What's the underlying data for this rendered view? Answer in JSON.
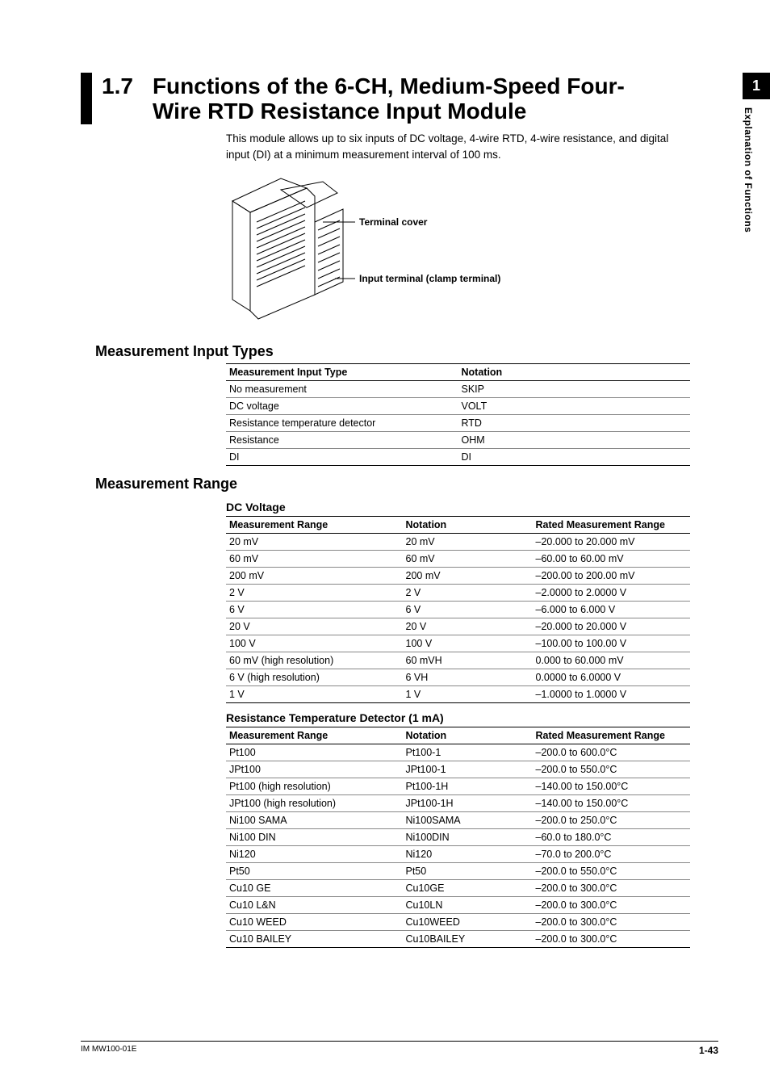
{
  "sidebar": {
    "chapter_num": "1",
    "chapter_label": "Explanation of Functions"
  },
  "header": {
    "number": "1.7",
    "title": "Functions of the 6-CH, Medium-Speed Four-Wire RTD Resistance Input Module"
  },
  "intro": "This module allows up to six inputs of DC voltage, 4-wire RTD, 4-wire resistance, and digital input (DI) at a minimum measurement interval of 100 ms.",
  "diagram": {
    "callout1": "Terminal cover",
    "callout2": "Input terminal (clamp terminal)"
  },
  "sec_input_types": {
    "heading": "Measurement Input Types",
    "cols": [
      "Measurement Input Type",
      "Notation"
    ],
    "rows": [
      [
        "No measurement",
        "SKIP"
      ],
      [
        "DC voltage",
        "VOLT"
      ],
      [
        "Resistance temperature detector",
        "RTD"
      ],
      [
        "Resistance",
        "OHM"
      ],
      [
        "DI",
        "DI"
      ]
    ]
  },
  "sec_range": {
    "heading": "Measurement Range",
    "dcv": {
      "title": "DC Voltage",
      "cols": [
        "Measurement Range",
        "Notation",
        "Rated Measurement Range"
      ],
      "rows": [
        [
          "20 mV",
          "20 mV",
          "–20.000 to 20.000 mV"
        ],
        [
          "60 mV",
          "60 mV",
          "–60.00 to 60.00 mV"
        ],
        [
          "200 mV",
          "200 mV",
          "–200.00 to 200.00 mV"
        ],
        [
          "2 V",
          "2 V",
          "–2.0000 to 2.0000 V"
        ],
        [
          "6 V",
          "6 V",
          "–6.000 to 6.000 V"
        ],
        [
          "20 V",
          "20 V",
          "–20.000 to 20.000 V"
        ],
        [
          "100 V",
          "100 V",
          "–100.00 to 100.00 V"
        ],
        [
          "60 mV (high resolution)",
          "60 mVH",
          "0.000 to 60.000 mV"
        ],
        [
          "6 V (high resolution)",
          "6 VH",
          "0.0000 to 6.0000 V"
        ],
        [
          "1 V",
          "1 V",
          "–1.0000 to 1.0000 V"
        ]
      ]
    },
    "rtd": {
      "title": "Resistance Temperature Detector (1 mA)",
      "cols": [
        "Measurement Range",
        "Notation",
        "Rated Measurement Range"
      ],
      "rows": [
        [
          "Pt100",
          "Pt100-1",
          "–200.0 to 600.0°C"
        ],
        [
          "JPt100",
          "JPt100-1",
          "–200.0 to 550.0°C"
        ],
        [
          "Pt100 (high resolution)",
          "Pt100-1H",
          "–140.00 to 150.00°C"
        ],
        [
          "JPt100 (high resolution)",
          "JPt100-1H",
          "–140.00 to 150.00°C"
        ],
        [
          "Ni100 SAMA",
          "Ni100SAMA",
          "–200.0 to 250.0°C"
        ],
        [
          "Ni100 DIN",
          "Ni100DIN",
          "–60.0 to 180.0°C"
        ],
        [
          "Ni120",
          "Ni120",
          "–70.0 to 200.0°C"
        ],
        [
          "Pt50",
          "Pt50",
          "–200.0 to 550.0°C"
        ],
        [
          "Cu10 GE",
          "Cu10GE",
          "–200.0 to 300.0°C"
        ],
        [
          "Cu10 L&N",
          "Cu10LN",
          "–200.0 to 300.0°C"
        ],
        [
          "Cu10 WEED",
          "Cu10WEED",
          "–200.0 to 300.0°C"
        ],
        [
          "Cu10 BAILEY",
          "Cu10BAILEY",
          "–200.0 to 300.0°C"
        ]
      ]
    }
  },
  "footer": {
    "left": "IM MW100-01E",
    "right": "1-43"
  }
}
